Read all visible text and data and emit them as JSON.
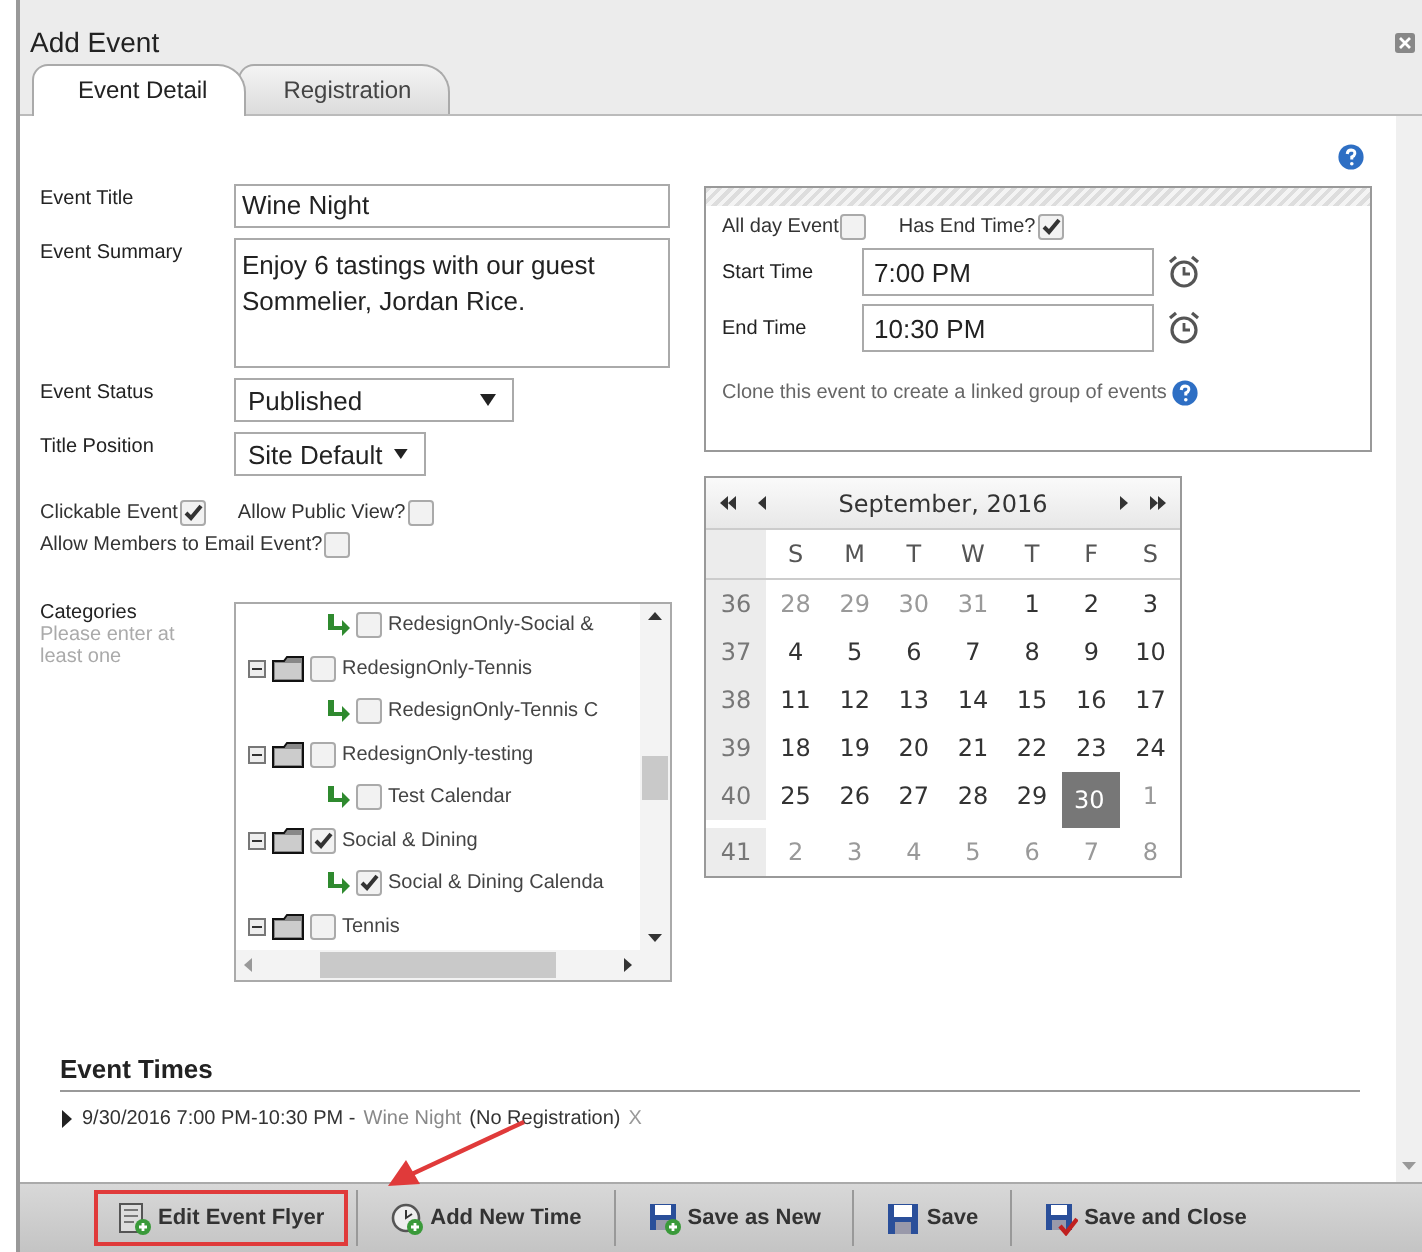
{
  "window": {
    "title": "Add Event"
  },
  "tabs": [
    {
      "label": "Event Detail",
      "selected": true
    },
    {
      "label": "Registration",
      "selected": false
    }
  ],
  "form": {
    "title": {
      "label": "Event Title",
      "value": "Wine Night"
    },
    "summary": {
      "label": "Event Summary",
      "value": "Enjoy 6 tastings with our guest Sommelier, Jordan Rice."
    },
    "status": {
      "label": "Event Status",
      "value": "Published"
    },
    "title_position": {
      "label": "Title Position",
      "value": "Site Default"
    },
    "options": [
      {
        "label": "Clickable Event",
        "checked": true
      },
      {
        "label": "Allow Public View?",
        "checked": false
      },
      {
        "label": "Allow Members to Email Event?",
        "checked": false
      }
    ],
    "categories": {
      "label": "Categories",
      "hint": "Please enter at least one",
      "items": [
        {
          "kind": "calendar",
          "label": "RedesignOnly-Social &",
          "checked": false
        },
        {
          "kind": "folder",
          "label": "RedesignOnly-Tennis",
          "checked": false,
          "expanded": true,
          "children": [
            {
              "kind": "calendar",
              "label": "RedesignOnly-Tennis C",
              "checked": false
            }
          ]
        },
        {
          "kind": "folder",
          "label": "RedesignOnly-testing",
          "checked": false,
          "expanded": true,
          "children": [
            {
              "kind": "calendar",
              "label": "Test Calendar",
              "checked": false
            }
          ]
        },
        {
          "kind": "folder",
          "label": "Social & Dining",
          "checked": true,
          "expanded": true,
          "children": [
            {
              "kind": "calendar",
              "label": "Social & Dining Calenda",
              "checked": true
            }
          ]
        },
        {
          "kind": "folder",
          "label": "Tennis",
          "checked": false,
          "expanded": true
        }
      ]
    }
  },
  "time_panel": {
    "all_day": {
      "label": "All day Event",
      "checked": false
    },
    "has_end": {
      "label": "Has End Time?",
      "checked": true
    },
    "start": {
      "label": "Start Time",
      "value": "7:00 PM"
    },
    "end": {
      "label": "End Time",
      "value": "10:30 PM"
    },
    "clone_text": "Clone this event to create a linked group of events"
  },
  "calendar": {
    "month": "September, 2016",
    "weekdays": [
      "S",
      "M",
      "T",
      "W",
      "T",
      "F",
      "S"
    ],
    "weeks": [
      {
        "week": "36",
        "days": [
          {
            "n": "28",
            "other_month": true,
            "selected": false
          },
          {
            "n": "29",
            "other_month": true,
            "selected": false
          },
          {
            "n": "30",
            "other_month": true,
            "selected": false
          },
          {
            "n": "31",
            "other_month": true,
            "selected": false
          },
          {
            "n": "1",
            "other_month": false,
            "selected": false
          },
          {
            "n": "2",
            "other_month": false,
            "selected": false
          },
          {
            "n": "3",
            "other_month": false,
            "selected": false
          }
        ]
      },
      {
        "week": "37",
        "days": [
          {
            "n": "4",
            "other_month": false,
            "selected": false
          },
          {
            "n": "5",
            "other_month": false,
            "selected": false
          },
          {
            "n": "6",
            "other_month": false,
            "selected": false
          },
          {
            "n": "7",
            "other_month": false,
            "selected": false
          },
          {
            "n": "8",
            "other_month": false,
            "selected": false
          },
          {
            "n": "9",
            "other_month": false,
            "selected": false
          },
          {
            "n": "10",
            "other_month": false,
            "selected": false
          }
        ]
      },
      {
        "week": "38",
        "days": [
          {
            "n": "11",
            "other_month": false,
            "selected": false
          },
          {
            "n": "12",
            "other_month": false,
            "selected": false
          },
          {
            "n": "13",
            "other_month": false,
            "selected": false
          },
          {
            "n": "14",
            "other_month": false,
            "selected": false
          },
          {
            "n": "15",
            "other_month": false,
            "selected": false
          },
          {
            "n": "16",
            "other_month": false,
            "selected": false
          },
          {
            "n": "17",
            "other_month": false,
            "selected": false
          }
        ]
      },
      {
        "week": "39",
        "days": [
          {
            "n": "18",
            "other_month": false,
            "selected": false
          },
          {
            "n": "19",
            "other_month": false,
            "selected": false
          },
          {
            "n": "20",
            "other_month": false,
            "selected": false
          },
          {
            "n": "21",
            "other_month": false,
            "selected": false
          },
          {
            "n": "22",
            "other_month": false,
            "selected": false
          },
          {
            "n": "23",
            "other_month": false,
            "selected": false
          },
          {
            "n": "24",
            "other_month": false,
            "selected": false
          }
        ]
      },
      {
        "week": "40",
        "days": [
          {
            "n": "25",
            "other_month": false,
            "selected": false
          },
          {
            "n": "26",
            "other_month": false,
            "selected": false
          },
          {
            "n": "27",
            "other_month": false,
            "selected": false
          },
          {
            "n": "28",
            "other_month": false,
            "selected": false
          },
          {
            "n": "29",
            "other_month": false,
            "selected": false
          },
          {
            "n": "30",
            "other_month": false,
            "selected": true
          },
          {
            "n": "1",
            "other_month": true,
            "selected": false
          }
        ]
      },
      {
        "week": "41",
        "days": [
          {
            "n": "2",
            "other_month": true,
            "selected": false
          },
          {
            "n": "3",
            "other_month": true,
            "selected": false
          },
          {
            "n": "4",
            "other_month": true,
            "selected": false
          },
          {
            "n": "5",
            "other_month": true,
            "selected": false
          },
          {
            "n": "6",
            "other_month": true,
            "selected": false
          },
          {
            "n": "7",
            "other_month": true,
            "selected": false
          },
          {
            "n": "8",
            "other_month": true,
            "selected": false
          }
        ]
      }
    ]
  },
  "event_times": {
    "heading": "Event Times",
    "entries": [
      {
        "when": "9/30/2016 7:00 PM-10:30 PM -",
        "name": "Wine Night",
        "note": "(No Registration)",
        "remove": "X",
        "expanded": false
      }
    ]
  },
  "toolbar": [
    {
      "kind": "flyer",
      "label": "Edit Event Flyer",
      "highlighted": true
    },
    {
      "kind": "time",
      "label": "Add New Time",
      "highlighted": false
    },
    {
      "kind": "save_new",
      "label": "Save as New",
      "highlighted": false
    },
    {
      "kind": "save",
      "label": "Save",
      "highlighted": false
    },
    {
      "kind": "save_close",
      "label": "Save and Close",
      "highlighted": false
    }
  ]
}
